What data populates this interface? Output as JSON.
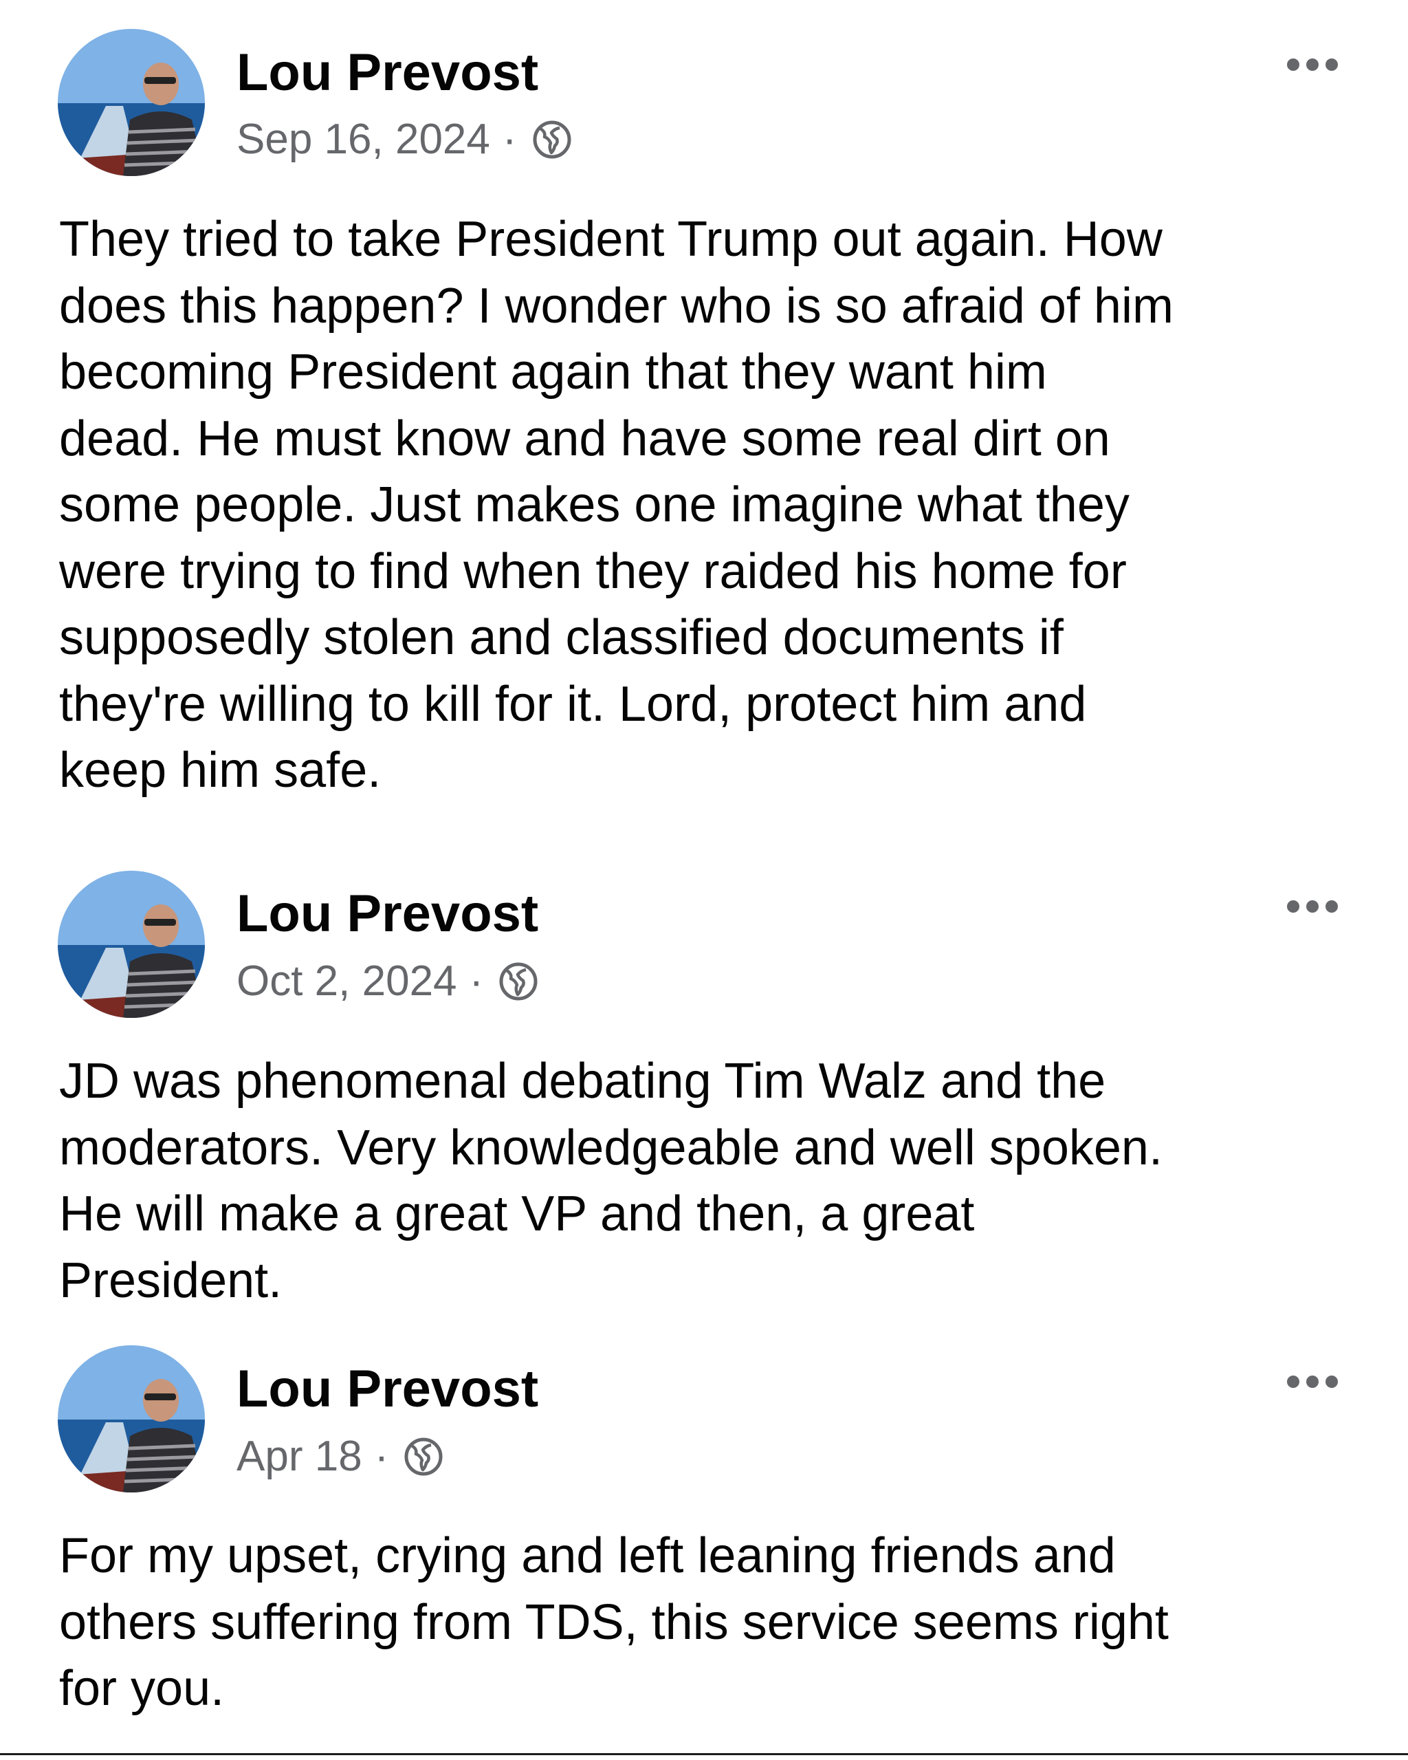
{
  "colors": {
    "author": "#050505",
    "meta": "#65676b",
    "body": "#050505",
    "background": "#ffffff"
  },
  "posts": [
    {
      "author": "Lou Prevost",
      "date": "Sep 16, 2024",
      "separator": "·",
      "privacy_icon": "globe-icon",
      "menu_icon": "more-options-icon",
      "text": "They tried to take President Trump out again.  How\ndoes this happen?  I wonder who is so afraid of him\nbecoming President again that they want him\ndead. He must know and have some real dirt on\nsome people.  Just makes one imagine what they\nwere trying to find when they raided his home for\nsupposedly stolen and classified documents if\nthey're willing to kill for it.  Lord, protect him and\nkeep him safe."
    },
    {
      "author": "Lou Prevost",
      "date": "Oct 2, 2024",
      "separator": "·",
      "privacy_icon": "globe-icon",
      "menu_icon": "more-options-icon",
      "text": "JD was phenomenal debating Tim Walz and the\nmoderators.  Very knowledgeable and well spoken.\nHe will make a great VP and then, a great\nPresident."
    },
    {
      "author": "Lou Prevost",
      "date": "Apr 18",
      "separator": "·",
      "privacy_icon": "globe-icon",
      "menu_icon": "more-options-icon",
      "text": "For my upset, crying and left leaning friends and\nothers suffering from TDS, this service seems right\nfor you."
    }
  ]
}
